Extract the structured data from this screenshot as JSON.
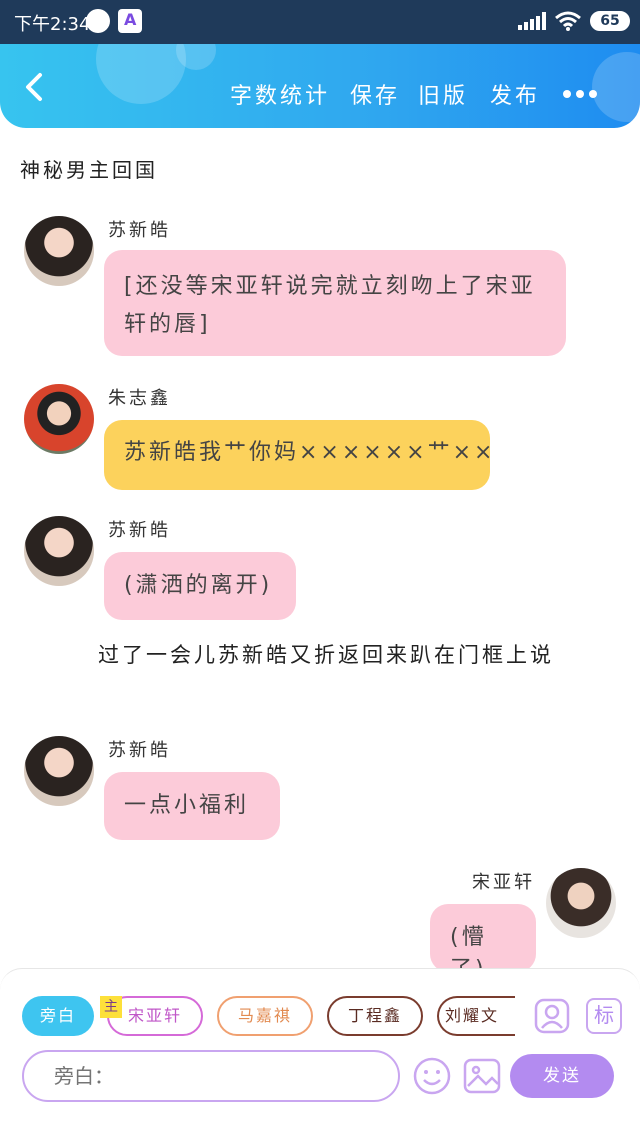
{
  "status_bar": {
    "time": "下午2:34",
    "battery": "65"
  },
  "header": {
    "actions": [
      "字数统计",
      "保存",
      "旧版",
      "发布"
    ]
  },
  "story": {
    "title": "神秘男主回国",
    "messages": [
      {
        "speaker": "苏新皓",
        "text": "[还没等宋亚轩说完就立刻吻上了宋亚轩的唇]",
        "color": "#fccbd9"
      },
      {
        "speaker": "朱志鑫",
        "text": "苏新皓我艹你妈××××××艹×××××××××",
        "color": "#fcd25c"
      },
      {
        "speaker": "苏新皓",
        "text": "(潇洒的离开)",
        "color": "#fccbd9"
      },
      {
        "narration": "过了一会儿苏新皓又折返回来趴在门框上说"
      },
      {
        "speaker": "苏新皓",
        "text": "一点小福利",
        "color": "#fccbd9"
      },
      {
        "speaker": "宋亚轩",
        "text": "(懵了)",
        "color": "#fccbd9"
      }
    ]
  },
  "composer": {
    "roles": [
      "旁白",
      "宋亚轩",
      "马嘉祺",
      "丁程鑫",
      "刘耀文"
    ],
    "main_tag": "主",
    "tools_badge": "标",
    "input_placeholder": "旁白：",
    "send_label": "发送"
  },
  "colors": {
    "header_start": "#37c4ef",
    "header_end": "#1e8cf0",
    "pink_bubble": "#fccbd9",
    "yellow_bubble": "#fcd25c",
    "send_button": "#b38bf0",
    "narrator_chip": "#3ec5f0"
  }
}
